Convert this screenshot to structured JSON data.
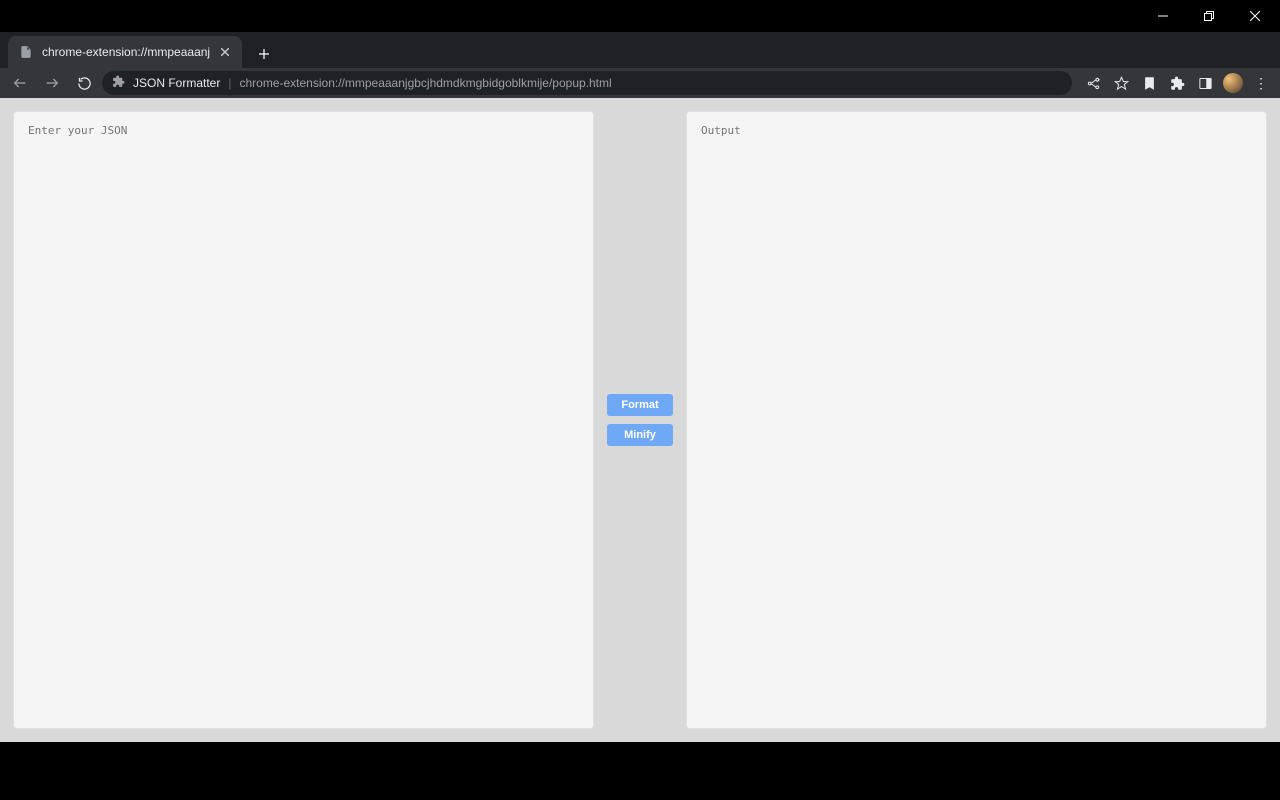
{
  "os_window": {
    "minimize_tooltip": "Minimize",
    "maximize_tooltip": "Restore Down",
    "close_tooltip": "Close"
  },
  "browser": {
    "tab": {
      "title": "chrome-extension://mmpeaaanj",
      "close_tooltip": "Close tab"
    },
    "new_tab_tooltip": "New tab",
    "nav": {
      "back_tooltip": "Back",
      "forward_tooltip": "Forward",
      "reload_tooltip": "Reload"
    },
    "omnibox": {
      "extension_name": "JSON Formatter",
      "url_path": "chrome-extension://mmpeaaanjgbcjhdmdkmgbidgoblkmije/popup.html"
    },
    "actions": {
      "share_tooltip": "Share this page",
      "bookmark_tooltip": "Bookmark this tab",
      "reading_list_tooltip": "Reading list",
      "extensions_tooltip": "Extensions",
      "side_panel_tooltip": "Side panel",
      "profile_tooltip": "Profile",
      "menu_tooltip": "Customize and control"
    }
  },
  "app": {
    "input_placeholder": "Enter your JSON",
    "output_placeholder": "Output",
    "input_value": "",
    "output_value": "",
    "format_button": "Format",
    "minify_button": "Minify"
  }
}
